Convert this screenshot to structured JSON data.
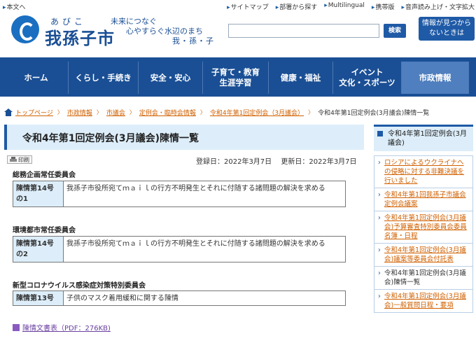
{
  "utility": {
    "skip": "本文へ",
    "links": [
      "サイトマップ",
      "部署から探す",
      "Multilingual",
      "携帯版",
      "音声読み上げ・文字拡大"
    ]
  },
  "header": {
    "logo_kana": "あびこ",
    "logo_name": "我孫子市",
    "tagline_1": "未来につなぐ",
    "tagline_2": "心やすらぐ水辺のまち",
    "tagline_3": "我・孫・子",
    "search_button": "検索",
    "help_button_1": "情報が見つから",
    "help_button_2": "ないときは"
  },
  "gnav": [
    {
      "label": "ホーム"
    },
    {
      "label": "くらし・手続き"
    },
    {
      "label": "安全・安心"
    },
    {
      "label": "子育て・教育\n生涯学習"
    },
    {
      "label": "健康・福祉"
    },
    {
      "label": "イベント\n文化・スポーツ"
    },
    {
      "label": "市政情報"
    }
  ],
  "breadcrumb": {
    "items": [
      "トップページ",
      "市政情報",
      "市議会",
      "定例会・臨時会情報",
      "令和4年第1回定例会（3月議会）"
    ],
    "current": "令和4年第1回定例会(3月議会)陳情一覧"
  },
  "main": {
    "title": "令和4年第1回定例会(3月議会)陳情一覧",
    "print_label": "印刷",
    "registered": "登録日：2022年3月7日",
    "updated": "更新日：2022年3月7日",
    "sections": [
      {
        "committee": "総務企画常任委員会",
        "number": "陳情第14号の1",
        "title": "我孫子市役所宛てｍａｉｌの行方不明発生とそれに付随する諸問題の解決を求める"
      },
      {
        "committee": "環境都市常任委員会",
        "number": "陳情第14号の2",
        "title": "我孫子市役所宛てｍａｉｌの行方不明発生とそれに付随する諸問題の解決を求める"
      },
      {
        "committee": "新型コロナウイルス感染症対策特別委員会",
        "number": "陳情第13号",
        "title": "子供のマスク着用緩和に関する陳情"
      }
    ],
    "pdf_link": "陳情文書表（PDF：276KB)"
  },
  "side": {
    "heading": "令和4年第1回定例会(3月議会)",
    "items": [
      "ロシアによるウクライナへの侵略に対する非難決議を行いました",
      "令和4年第1回我孫子市議会定例会議案",
      "令和4年第1回定例会(3月議会)予算審査特別委員会委員名簿・日程",
      "令和4年第1回定例会(3月議会)議案等委員会付託表",
      "令和4年第1回定例会(3月議会)陳情一覧",
      "令和4年第1回定例会(3月議会)一般質問日程・要項"
    ]
  },
  "colors": {
    "brand": "#1a4f95",
    "link": "#d06000",
    "accent_bg": "#ddeefa"
  }
}
